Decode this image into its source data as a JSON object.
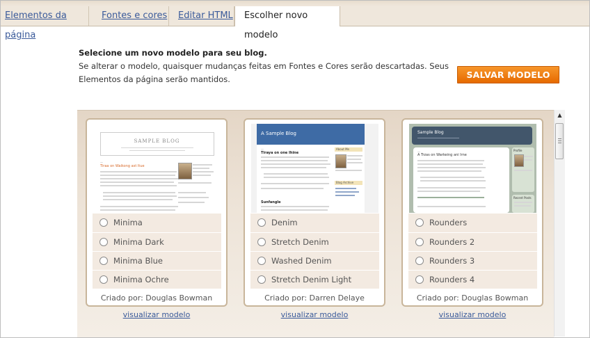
{
  "tabs": [
    {
      "label": "Elementos da página"
    },
    {
      "label": "Fontes e cores"
    },
    {
      "label": "Editar HTML"
    },
    {
      "label": "Escolher novo modelo"
    }
  ],
  "intro": {
    "line1": "Selecione um novo modelo para seu blog.",
    "line2": "Se alterar o modelo, quaisquer mudanças feitas em Fontes e Cores serão descartadas. Seus",
    "line3": "Elementos da página serão mantidos."
  },
  "save_button": "SALVAR MODELO",
  "templates": [
    {
      "thumb_title": "SAMPLE BLOG",
      "thumb_post_title": "Tiraa on Waikong ast Itue",
      "options": [
        "Minima",
        "Minima Dark",
        "Minima Blue",
        "Minima Ochre"
      ],
      "author": "Criado por: Douglas Bowman",
      "preview": "visualizar modelo"
    },
    {
      "thumb_title": "A Sample Blog",
      "thumb_post_title": "Tiraya on one Ihine",
      "thumb_side_heading": "About Me",
      "thumb_side_heading2": "Blog Archive",
      "thumb_section": "Sunfangle",
      "options": [
        "Denim",
        "Stretch Denim",
        "Washed Denim",
        "Stretch Denim Light"
      ],
      "author": "Criado por: Darren Delaye",
      "preview": "visualizar modelo"
    },
    {
      "thumb_title": "Sample Blog",
      "thumb_post_title": "A Trzas on Warkeing ani Irne",
      "thumb_side_heading": "Profile",
      "thumb_side_heading2": "Recent Posts",
      "options": [
        "Rounders",
        "Rounders 2",
        "Rounders 3",
        "Rounders 4"
      ],
      "author": "Criado por: Douglas Bowman",
      "preview": "visualizar modelo"
    }
  ],
  "colors": {
    "accent": "#f07d10",
    "link": "#3a5a9a",
    "denim_header": "#3e6ba5",
    "rounders_header": "#42566b",
    "card_border": "#c8b59a"
  },
  "icons": {
    "scroll_up": "triangle-up-icon",
    "radio": "radio-icon"
  }
}
